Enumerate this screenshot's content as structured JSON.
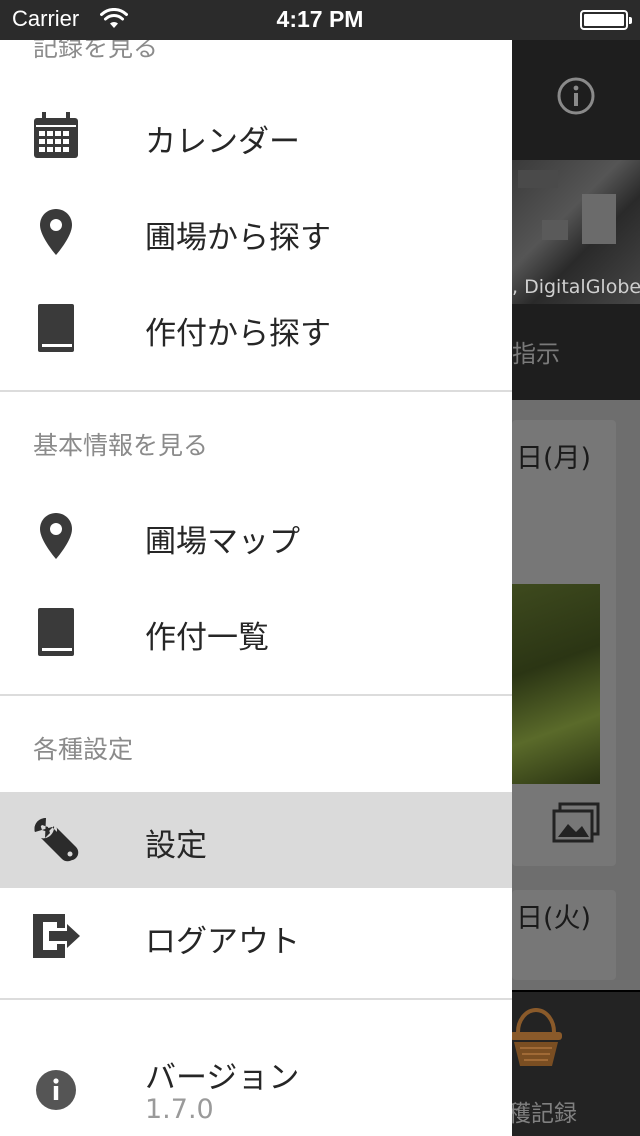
{
  "status_bar": {
    "carrier": "Carrier",
    "time": "4:17 PM"
  },
  "background": {
    "map_credit": ", DigitalGlobe",
    "display_label": "指示",
    "dates": [
      "日(月)",
      "日(火)"
    ],
    "tab_label": "穫記録"
  },
  "drawer": {
    "top_section_header": "記録を見る",
    "records": [
      {
        "label": "カレンダー",
        "icon": "calendar-icon"
      },
      {
        "label": "圃場から探す",
        "icon": "map-pin-icon"
      },
      {
        "label": "作付から探す",
        "icon": "book-icon"
      }
    ],
    "basic_info_header": "基本情報を見る",
    "basic_info": [
      {
        "label": "圃場マップ",
        "icon": "map-pin-icon"
      },
      {
        "label": "作付一覧",
        "icon": "book-icon"
      }
    ],
    "settings_header": "各種設定",
    "settings": [
      {
        "label": "設定",
        "icon": "wrench-icon",
        "selected": true
      },
      {
        "label": "ログアウト",
        "icon": "logout-icon"
      }
    ],
    "version": {
      "label": "バージョン",
      "value": "1.7.0",
      "icon": "info-icon"
    }
  },
  "colors": {
    "drawer_bg": "#ffffff",
    "selected_bg": "#dadada",
    "icon": "#3a3a3a",
    "section_text": "#8b8b8b"
  }
}
